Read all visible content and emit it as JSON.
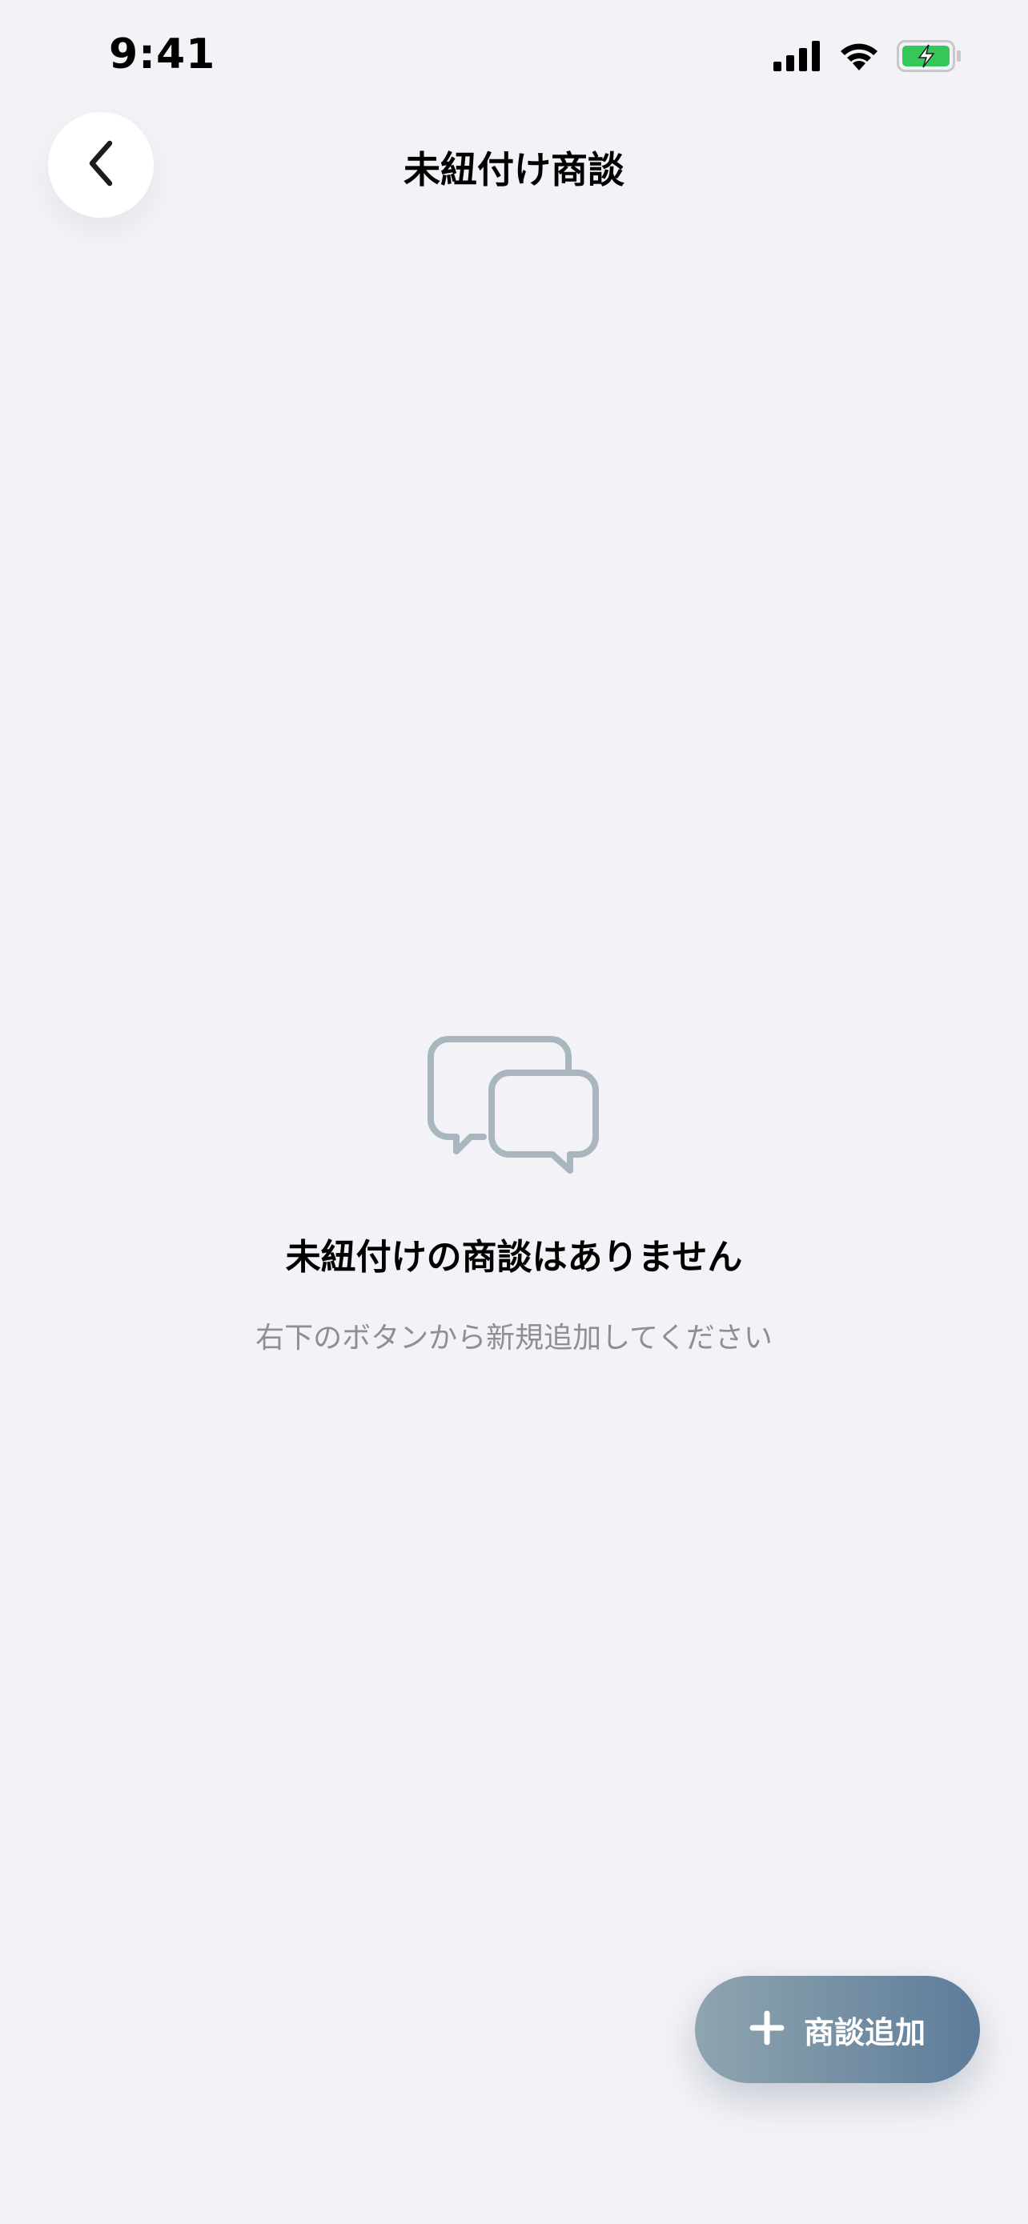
{
  "status_bar": {
    "time": "9:41",
    "battery_color": "#34C759"
  },
  "header": {
    "title": "未紐付け商談",
    "back_icon": "chevron-left-icon"
  },
  "empty_state": {
    "icon": "chat-bubbles-icon",
    "title": "未紐付けの商談はありません",
    "subtitle": "右下のボタンから新規追加してください",
    "icon_color": "#A9B6BE"
  },
  "fab": {
    "label": "商談追加",
    "icon": "plus-icon",
    "gradient_start": "#8FA5AF",
    "gradient_end": "#5D7C9A"
  },
  "colors": {
    "background": "#F2F2F7",
    "subtitle_text": "#8E8E93"
  }
}
